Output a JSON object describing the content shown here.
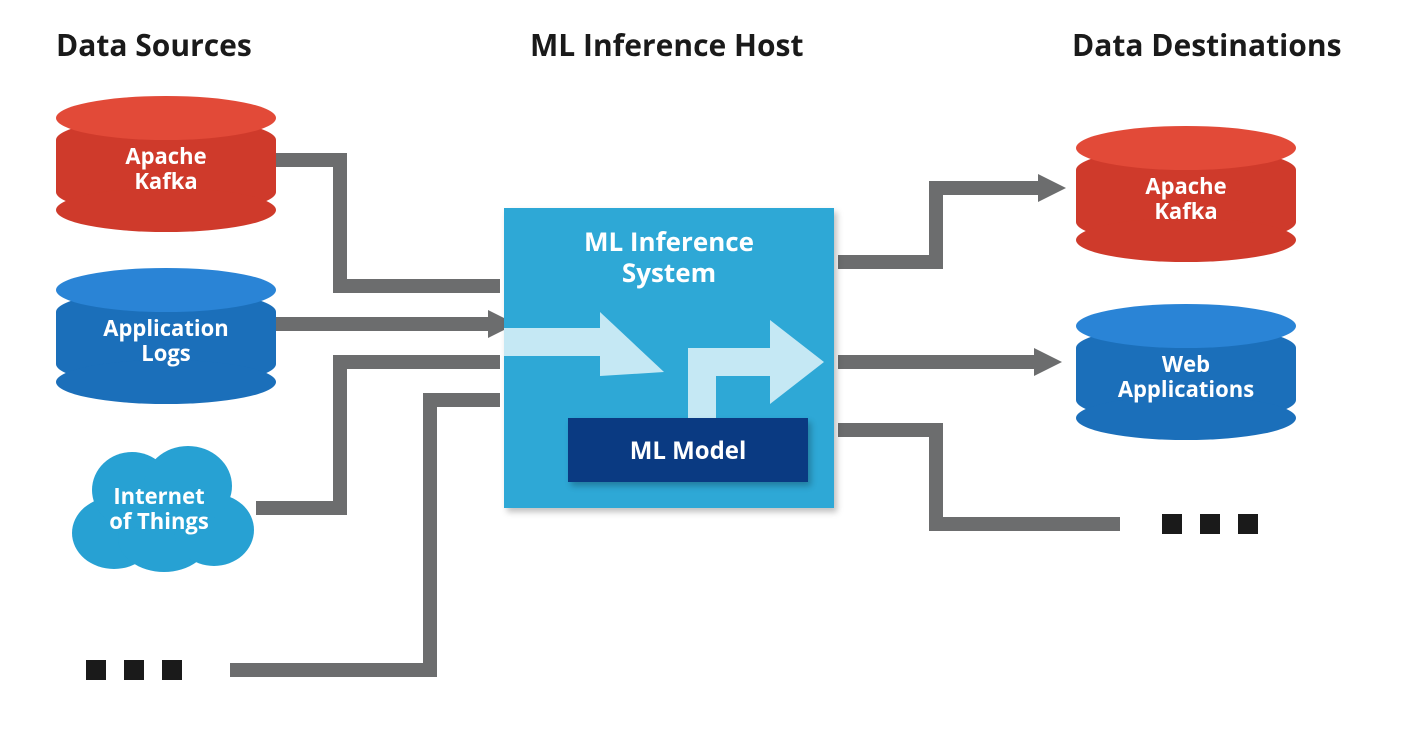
{
  "headings": {
    "sources": "Data Sources",
    "host": "ML Inference Host",
    "destinations": "Data Destinations"
  },
  "sources": {
    "kafka": "Apache\nKafka",
    "app_logs": "Application\nLogs",
    "iot": "Internet\nof Things",
    "more": "…"
  },
  "host_box": {
    "title": "ML Inference\nSystem",
    "model": "ML Model"
  },
  "destinations": {
    "kafka": "Apache\nKafka",
    "web_apps": "Web\nApplications",
    "more": "…"
  },
  "colors": {
    "red": "#cf3a2b",
    "blue": "#1b6fba",
    "host": "#2ea8d6",
    "model": "#0a3a82",
    "connector": "#6c6d6e",
    "flow": "#c5e8f4"
  }
}
